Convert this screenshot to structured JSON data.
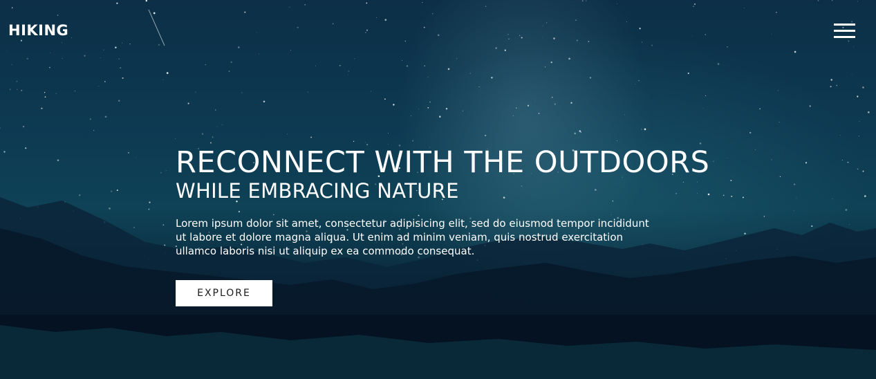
{
  "nav": {
    "brand": "HIKING",
    "menu_icon": "hamburger-menu-icon"
  },
  "hero": {
    "headline": "RECONNECT WITH THE OUTDOORS",
    "subheadline": "WHILE EMBRACING NATURE",
    "body": "Lorem ipsum dolor sit amet, consectetur adipisicing elit, sed do eiusmod tempor incididunt ut labore et dolore magna aliqua. Ut enim ad minim veniam, quis nostrud exercitation ullamco laboris nisi ut aliquip ex ea commodo consequat.",
    "cta_label": "EXPLORE"
  },
  "colors": {
    "text": "#ffffff",
    "button_bg": "#ffffff",
    "button_text": "#1a1a1a",
    "sky": "#0d3a52"
  }
}
